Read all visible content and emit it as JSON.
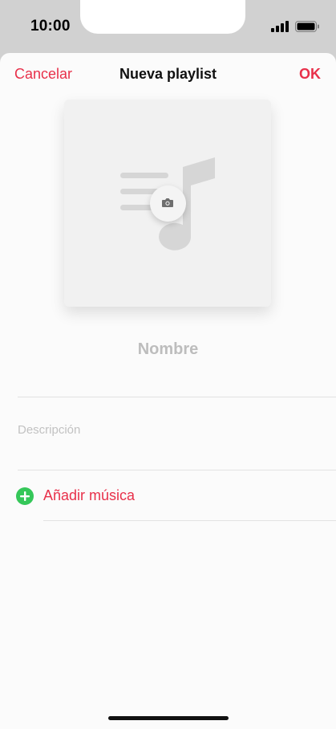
{
  "status_bar": {
    "time": "10:00"
  },
  "nav": {
    "cancel_label": "Cancelar",
    "title": "Nueva playlist",
    "ok_label": "OK"
  },
  "artwork": {
    "placeholder_icon": "music-note-icon",
    "camera_icon": "camera-icon"
  },
  "form": {
    "name_placeholder": "Nombre",
    "description_placeholder": "Descripción"
  },
  "actions": {
    "add_music_label": "Añadir música",
    "add_icon": "plus-circle-icon"
  },
  "colors": {
    "accent": "#e8304a",
    "add_green": "#35c759"
  }
}
